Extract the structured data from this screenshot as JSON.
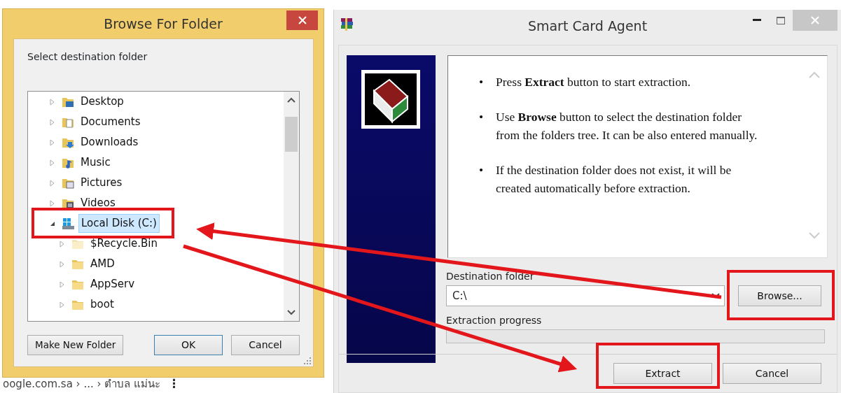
{
  "background_page": {
    "breadcrumb": "oogle.com.sa › ... › ตำบล แม่นะ",
    "menu_glyph": "⋮"
  },
  "browse_dialog": {
    "title": "Browse For Folder",
    "instruction": "Select destination folder",
    "tree": [
      {
        "label": "Desktop",
        "kind": "desktop",
        "expanded": false,
        "selected": false,
        "hidden": false
      },
      {
        "label": "Documents",
        "kind": "documents",
        "expanded": false,
        "selected": false,
        "hidden": false
      },
      {
        "label": "Downloads",
        "kind": "downloads",
        "expanded": false,
        "selected": false,
        "hidden": false
      },
      {
        "label": "Music",
        "kind": "music",
        "expanded": false,
        "selected": false,
        "hidden": false
      },
      {
        "label": "Pictures",
        "kind": "pictures",
        "expanded": false,
        "selected": false,
        "hidden": false
      },
      {
        "label": "Videos",
        "kind": "videos",
        "expanded": false,
        "selected": false,
        "hidden": false
      },
      {
        "label": "Local Disk (C:)",
        "kind": "drive",
        "expanded": true,
        "selected": true,
        "hidden": false,
        "children": [
          {
            "label": "$Recycle.Bin",
            "kind": "folder",
            "expanded": false,
            "selected": false,
            "hidden": true
          },
          {
            "label": "AMD",
            "kind": "folder",
            "expanded": false,
            "selected": false,
            "hidden": false
          },
          {
            "label": "AppServ",
            "kind": "folder",
            "expanded": false,
            "selected": false,
            "hidden": false
          },
          {
            "label": "boot",
            "kind": "folder",
            "expanded": false,
            "selected": false,
            "hidden": false
          }
        ]
      }
    ],
    "buttons": [
      {
        "label": "Make New Folder",
        "default": false
      },
      {
        "label": "OK",
        "default": true
      },
      {
        "label": "Cancel",
        "default": false
      }
    ]
  },
  "agent_window": {
    "title": "Smart Card Agent",
    "bullet": "•",
    "instructions": [
      "Press **Extract** button to start extraction.",
      "Use **Browse** button to select the destination folder from the folders tree. It can be also entered manually.",
      "If the destination folder does not exist, it will be created automatically before extraction."
    ],
    "destination_label": "Destination folder",
    "destination_value": "C:\\",
    "browse_button": "Browse...",
    "progress_label": "Extraction progress",
    "progress": {
      "level": 0
    },
    "buttons": [
      "Extract",
      "Cancel"
    ]
  }
}
